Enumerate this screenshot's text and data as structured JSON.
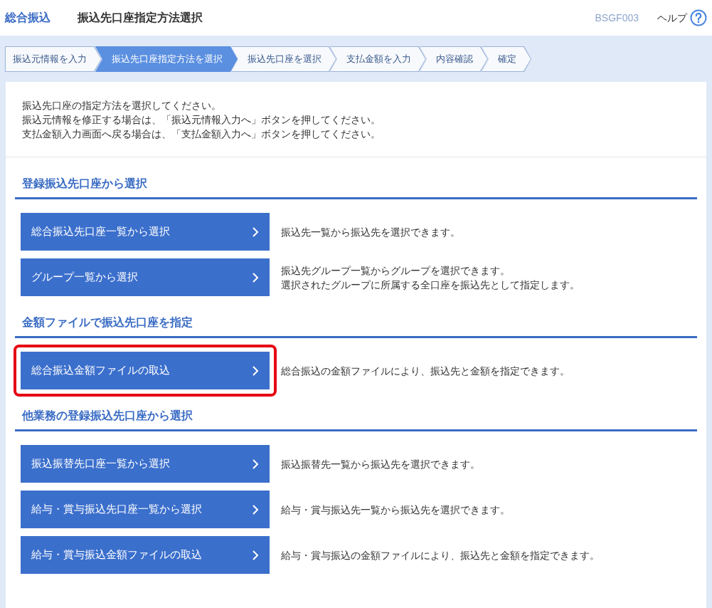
{
  "header": {
    "service": "総合振込",
    "title": "振込先口座指定方法選択",
    "screen_id": "BSGF003",
    "help": "ヘルプ"
  },
  "steps": [
    {
      "label": "振込元情報を入力",
      "selected": false
    },
    {
      "label": "振込先口座指定方法を選択",
      "selected": true
    },
    {
      "label": "振込先口座を選択",
      "selected": false
    },
    {
      "label": "支払金額を入力",
      "selected": false
    },
    {
      "label": "内容確認",
      "selected": false
    },
    {
      "label": "確定",
      "selected": false
    }
  ],
  "instructions": [
    "振込先口座の指定方法を選択してください。",
    "振込元情報を修正する場合は、「振込元情報入力へ」ボタンを押してください。",
    "支払金額入力画面へ戻る場合は、「支払金額入力へ」ボタンを押してください。"
  ],
  "sections": [
    {
      "heading": "登録振込先口座から選択",
      "options": [
        {
          "button": "総合振込先口座一覧から選択",
          "description": [
            "振込先一覧から振込先を選択できます。"
          ],
          "highlighted": false
        },
        {
          "button": "グループ一覧から選択",
          "description": [
            "振込先グループ一覧からグループを選択できます。",
            "選択されたグループに所属する全口座を振込先として指定します。"
          ],
          "highlighted": false
        }
      ]
    },
    {
      "heading": "金額ファイルで振込先口座を指定",
      "options": [
        {
          "button": "総合振込金額ファイルの取込",
          "description": [
            "総合振込の金額ファイルにより、振込先と金額を指定できます。"
          ],
          "highlighted": true
        }
      ]
    },
    {
      "heading": "他業務の登録振込先口座から選択",
      "options": [
        {
          "button": "振込振替先口座一覧から選択",
          "description": [
            "振込振替先一覧から振込先を選択できます。"
          ],
          "highlighted": false
        },
        {
          "button": "給与・賞与振込先口座一覧から選択",
          "description": [
            "給与・賞与振込先一覧から振込先を選択できます。"
          ],
          "highlighted": false
        },
        {
          "button": "給与・賞与振込金額ファイルの取込",
          "description": [
            "給与・賞与振込の金額ファイルにより、振込先と金額を指定できます。"
          ],
          "highlighted": false
        }
      ]
    }
  ]
}
